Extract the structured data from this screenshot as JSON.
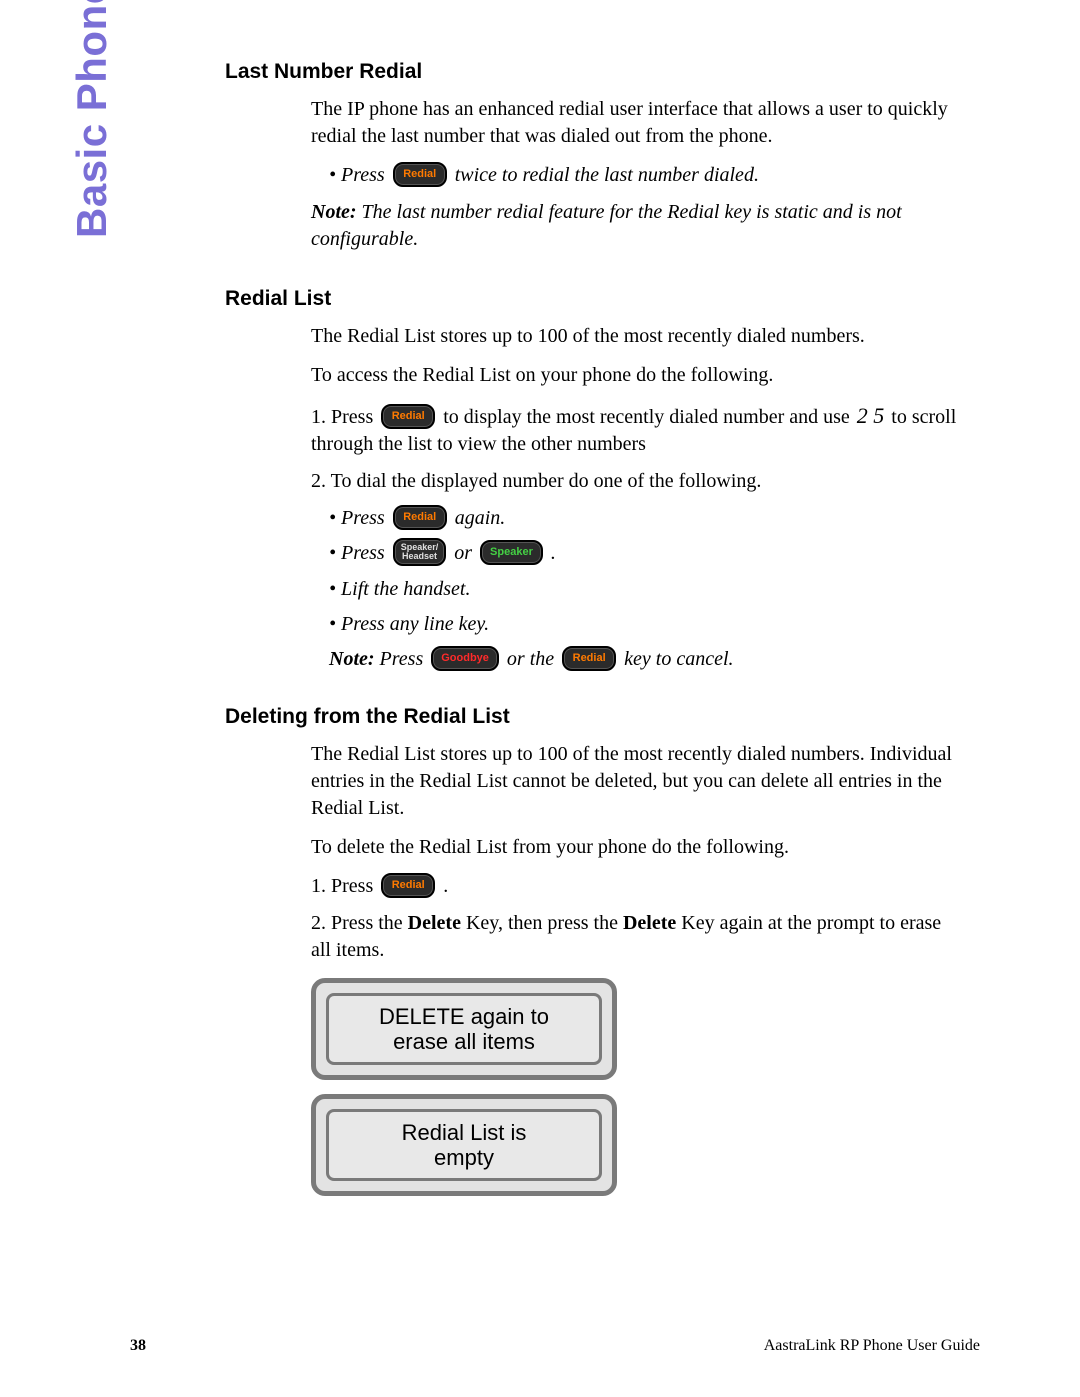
{
  "sideLabel": "Basic Phone Features",
  "sec1": {
    "title": "Last Number Redial",
    "p1": "The IP phone has an enhanced redial user interface that allows a user to quickly redial the last number that was dialed out from the phone.",
    "b1a": "Press ",
    "b1b": " twice to redial the last number dialed.",
    "noteLabel": "Note:",
    "noteText": " The last number redial feature for the Redial key is static and is not configurable."
  },
  "sec2": {
    "title": "Redial List",
    "p1": "The Redial List stores up to 100 of the most recently dialed numbers.",
    "p2": "To access the Redial List on your phone do the following.",
    "s1a": "1.  Press ",
    "s1b": " to display the most recently dialed number and use ",
    "s1scroll": "2 5",
    "s1c": " to scroll through the list to view the other numbers",
    "s2": "2.  To dial the displayed number do one of the following.",
    "sub1a": "Press ",
    "sub1b": " again.",
    "sub2a": "Press ",
    "sub2b": " or ",
    "sub2c": " .",
    "sub3": "Lift the handset.",
    "sub4": "Press any line key.",
    "noteLabel": "Note:",
    "note_a": " Press ",
    "note_b": " or the ",
    "note_c": " key to cancel."
  },
  "sec3": {
    "title": "Deleting from the Redial List",
    "p1": "The Redial List stores up to 100 of the most recently dialed numbers. Individual entries in the Redial List cannot be deleted, but you can delete all entries in the Redial List.",
    "p2": "To delete the Redial List from your phone do the following.",
    "s1a": "1.  Press ",
    "s1b": " .",
    "s2a": "2.  Press the ",
    "s2b": "Delete",
    "s2c": " Key, then press the ",
    "s2d": "Delete",
    "s2e": " Key again at the prompt to erase all items.",
    "screen1a": "DELETE again to",
    "screen1b": "erase all items",
    "screen2a": "Redial List is",
    "screen2b": "empty"
  },
  "buttons": {
    "redial": "Redial",
    "speakerHeadset": "Speaker/<br>Headset",
    "speaker": "Speaker",
    "goodbye": "Goodbye"
  },
  "footer": {
    "page": "38",
    "guide": "AastraLink RP Phone User Guide"
  }
}
